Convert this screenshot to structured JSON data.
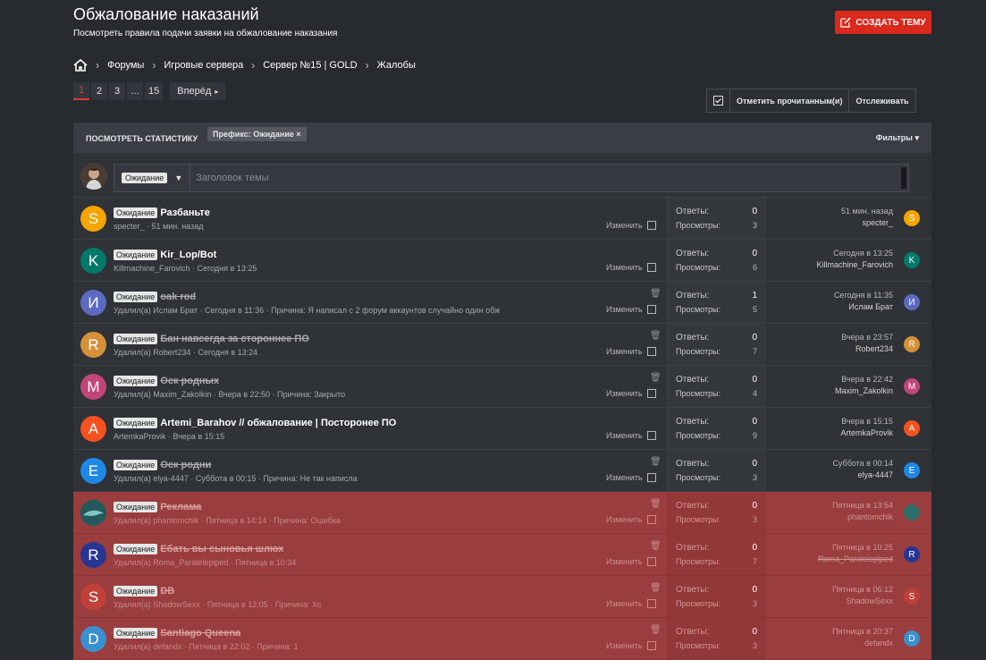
{
  "page": {
    "title": "Обжалование наказаний",
    "description": "Посмотреть правила подачи заявки на обжалование наказания",
    "create_button": "СОЗДАТЬ ТЕМУ"
  },
  "breadcrumb": [
    "Форумы",
    "Игровые сервера",
    "Сервер №15 | GOLD",
    "Жалобы"
  ],
  "pagination": {
    "pages": [
      "1",
      "2",
      "3",
      "...",
      "15"
    ],
    "next": "Вперёд"
  },
  "actions": {
    "mark_read": "Отметить прочитанным(и)",
    "watch": "Отслеживать"
  },
  "filterbar": {
    "stats": "ПОСМОТРЕТЬ СТАТИСТИКУ",
    "prefix_chip": "Префикс: Ожидание ×",
    "filters": "Фильтры"
  },
  "new_thread": {
    "prefix": "Ожидание",
    "placeholder": "Заголовок темы"
  },
  "labels": {
    "replies": "Ответы:",
    "views": "Просмотры:",
    "edit": "Изменить"
  },
  "threads": [
    {
      "letter": "S",
      "color": "#f5a400",
      "prefix": "Ожидание",
      "title": "Разбаньте",
      "deleted": false,
      "meta": "specter_ · 51 мин. назад",
      "replies": "0",
      "views": "3",
      "last_date": "51 мин. назад",
      "last_user": "specter_",
      "red": false
    },
    {
      "letter": "K",
      "color": "#00796b",
      "prefix": "Ожидание",
      "title": "Kir_Lop/Bot",
      "deleted": false,
      "meta": "Killmachine_Farovich · Сегодня в 13:25",
      "replies": "0",
      "views": "6",
      "last_date": "Сегодня в 13:25",
      "last_user": "Killmachine_Farovich",
      "red": false
    },
    {
      "letter": "И",
      "color": "#5c6bc0",
      "prefix": "Ожидание",
      "title": "oak rod",
      "deleted": true,
      "meta": "Удалил(а) Ислам Брат · Сегодня в 11:36 · Причина: Я написал с 2 форум аккаунтов случайно один обж",
      "replies": "1",
      "views": "5",
      "last_date": "Сегодня в 11:35",
      "last_user": "Ислам Брат",
      "red": false
    },
    {
      "letter": "R",
      "color": "#d4913a",
      "prefix": "Ожидание",
      "title": "Бан навсегда за стороннее ПО",
      "deleted": true,
      "meta": "Удалил(а) Robert234 · Сегодня в 13:24",
      "replies": "0",
      "views": "7",
      "last_date": "Вчера в 23:57",
      "last_user": "Robert234",
      "red": false
    },
    {
      "letter": "M",
      "color": "#c2457a",
      "prefix": "Ожидание",
      "title": "Оск родных",
      "deleted": true,
      "meta": "Удалил(а) Maxim_Zakolkin · Вчера в 22:50 · Причина: Закрыто",
      "replies": "0",
      "views": "4",
      "last_date": "Вчера в 22:42",
      "last_user": "Maxim_Zakolkin",
      "red": false
    },
    {
      "letter": "A",
      "color": "#f4511e",
      "prefix": "Ожидание",
      "title": "Artemi_Barahov // обжалование | Посторонее ПО",
      "deleted": false,
      "meta": "ArtemkaProvik · Вчера в 15:15",
      "replies": "0",
      "views": "9",
      "last_date": "Вчера в 15:15",
      "last_user": "ArtemkaProvik",
      "red": false
    },
    {
      "letter": "E",
      "color": "#1e88e5",
      "prefix": "Ожидание",
      "title": "Оск родни",
      "deleted": true,
      "meta": "Удалил(а) elya-4447 · Суббота в 00:15 · Причина: Не так написла",
      "replies": "0",
      "views": "3",
      "last_date": "Суббота в 00:14",
      "last_user": "elya-4447",
      "red": false
    },
    {
      "letter": "",
      "color": "#2e6e6a",
      "prefix": "Ожидание",
      "title": "Реклама",
      "deleted": true,
      "meta": "Удалил(а) phantomchik · Пятница в 14:14 · Причина: Ошибка",
      "replies": "0",
      "views": "3",
      "last_date": "Пятница в 13:54",
      "last_user": "phantomchik",
      "red": true
    },
    {
      "letter": "R",
      "color": "#283593",
      "prefix": "Ожидание",
      "title": "Ебать вы сыновья шлюх",
      "deleted": true,
      "meta": "Удалил(а) Roma_Paralelepiped · Пятница в 10:34",
      "replies": "0",
      "views": "7",
      "last_date": "Пятница в 10:25",
      "last_user": "Roma_Paralelepiped",
      "red": true
    },
    {
      "letter": "S",
      "color": "#c0413a",
      "prefix": "Ожидание",
      "title": "DB",
      "deleted": true,
      "meta": "Удалил(а) ShadowSexx · Пятница в 12:05 · Причина: Хс",
      "replies": "0",
      "views": "3",
      "last_date": "Пятница в 06:12",
      "last_user": "ShadowSexx",
      "red": true
    },
    {
      "letter": "D",
      "color": "#3a8fcf",
      "prefix": "Ожидание",
      "title": "Santiago Queena",
      "deleted": true,
      "meta": "Удалил(а) defandx · Пятница в 22:02 · Причина: 1",
      "replies": "0",
      "views": "3",
      "last_date": "Пятница в 20:37",
      "last_user": "defandx",
      "red": true
    }
  ]
}
